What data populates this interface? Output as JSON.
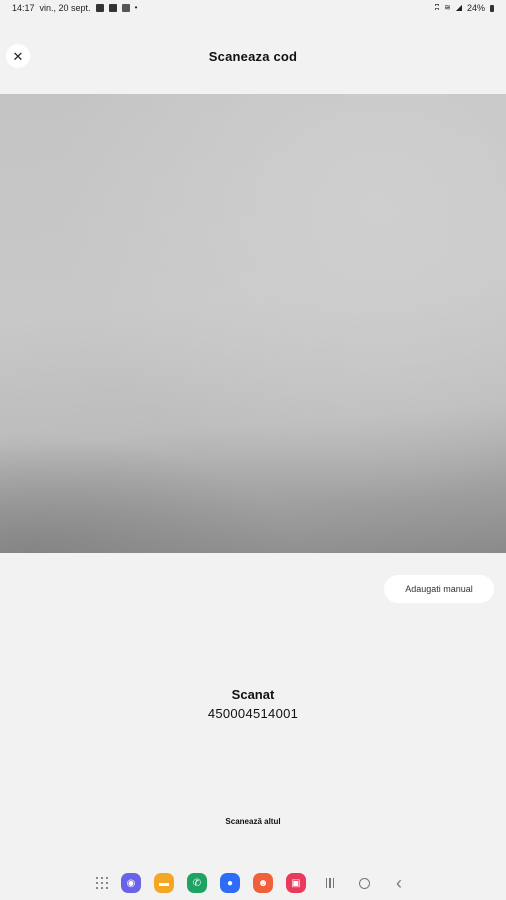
{
  "status_bar": {
    "time": "14:17",
    "date": "vin., 20 sept.",
    "battery": "24%",
    "icons": [
      "gallery-icon",
      "check-icon",
      "nfc-icon",
      "dot-icon"
    ],
    "right_icons": [
      "bluetooth-icon",
      "wifi-icon",
      "signal-icon",
      "battery-icon"
    ]
  },
  "header": {
    "close_label": "✕",
    "title": "Scaneaza cod"
  },
  "manual_add_label": "Adaugati manual",
  "scan_result": {
    "label": "Scanat",
    "code": "450004514001"
  },
  "scan_again_label": "Scanează altul",
  "nav_bar": {
    "apps": [
      {
        "name": "internet-app-icon",
        "color": "#6b63e6",
        "glyph": "◉"
      },
      {
        "name": "files-app-icon",
        "color": "#f5a623",
        "glyph": "▬"
      },
      {
        "name": "phone-app-icon",
        "color": "#1fa363",
        "glyph": "✆"
      },
      {
        "name": "messages-app-icon",
        "color": "#2d6df6",
        "glyph": "●"
      },
      {
        "name": "contacts-app-icon",
        "color": "#f0613a",
        "glyph": "☻"
      },
      {
        "name": "video-app-icon",
        "color": "#e83a5c",
        "glyph": "▣"
      }
    ],
    "back_glyph": "‹"
  }
}
